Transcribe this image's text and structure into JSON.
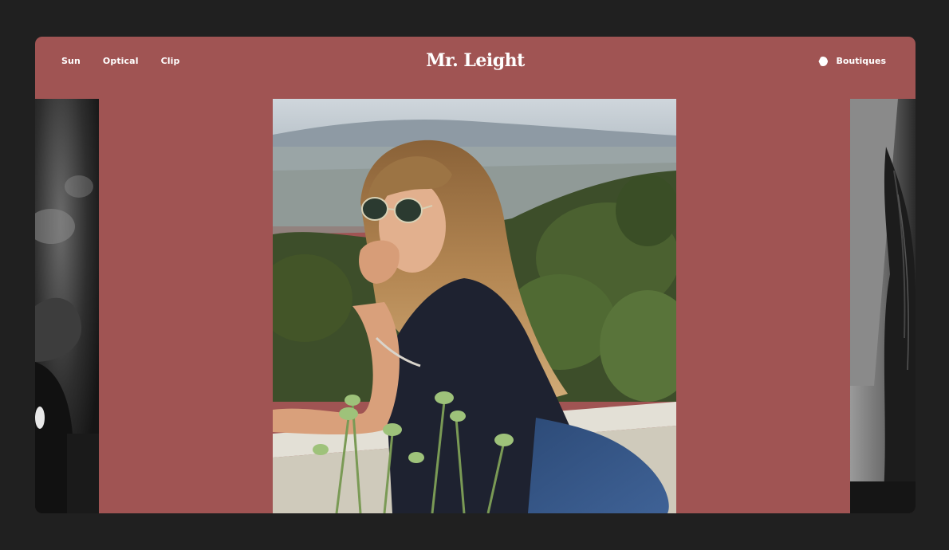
{
  "header": {
    "nav": [
      {
        "label": "Sun"
      },
      {
        "label": "Optical"
      },
      {
        "label": "Clip"
      }
    ],
    "logo": "Mr. Leight",
    "boutiques_label": "Boutiques"
  },
  "colors": {
    "page_background": "#202020",
    "brand_background": "#a05453",
    "text": "#ffffff"
  },
  "gallery": {
    "left_image": "black-and-white-portrait-photo",
    "hero_image": "woman-in-sunglasses-on-balcony-photo",
    "right_image": "black-and-white-portrait-photo"
  }
}
